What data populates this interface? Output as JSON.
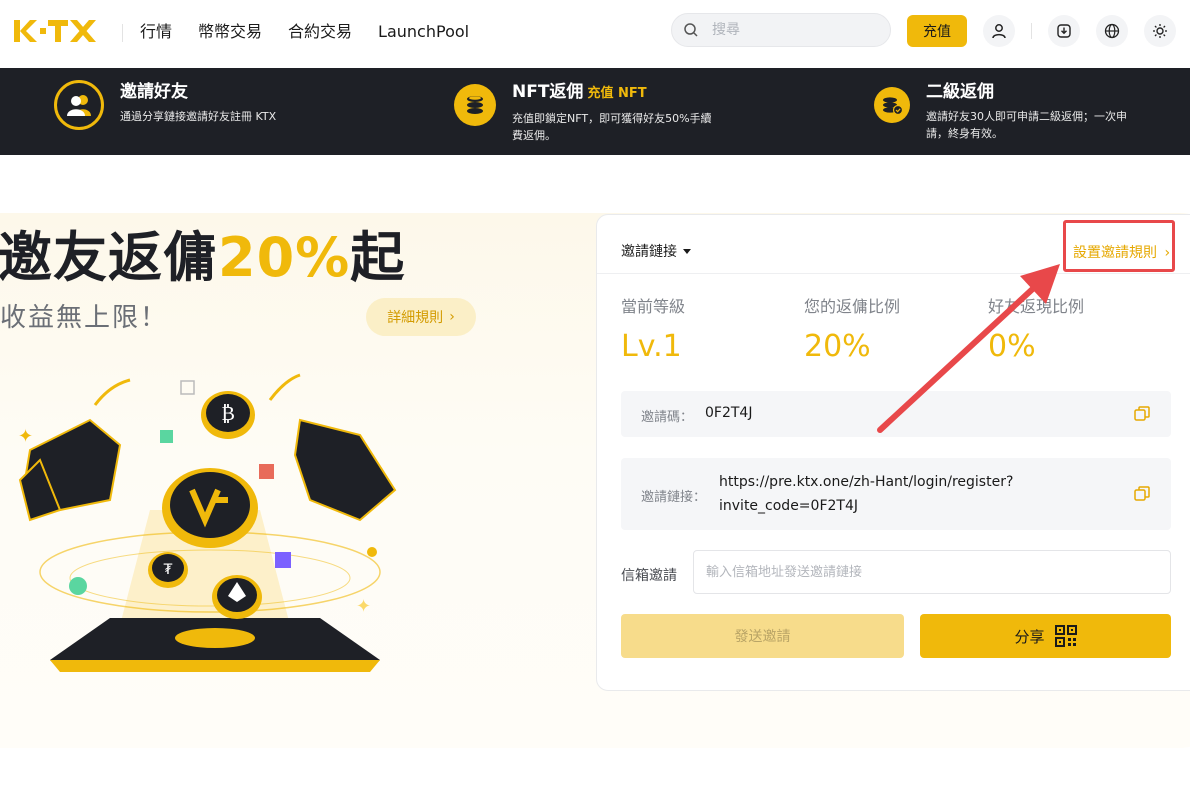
{
  "nav": {
    "links": [
      "行情",
      "幣幣交易",
      "合約交易",
      "LaunchPool"
    ],
    "search_placeholder": "搜尋",
    "deposit_label": "充值",
    "icons": [
      "search-icon",
      "user-icon",
      "download-icon",
      "globe-icon",
      "theme-sun-icon"
    ]
  },
  "banner": {
    "items": [
      {
        "title": "邀請好友",
        "highlight": "",
        "desc": "通過分享鏈接邀請好友註冊 KTX",
        "icon": "friends-icon"
      },
      {
        "title": "NFT返佣",
        "highlight": "充值 NFT",
        "desc": "充值即鎖定NFT，即可獲得好友50%手續費返佣。",
        "icon": "coin-stack-icon"
      },
      {
        "title": "二級返佣",
        "highlight": "",
        "desc": "邀請好友30人即可申請二級返佣；一次申請，終身有效。",
        "icon": "coin-stack-check-icon"
      }
    ]
  },
  "hero": {
    "title_prefix": "邀友返傭",
    "title_pct": "20%",
    "title_suffix": "起",
    "subtitle": "收益無上限！",
    "rules_label": "詳細規則"
  },
  "card": {
    "link_select": "邀請鏈接",
    "set_rules": "設置邀請規則",
    "stats": [
      {
        "label": "當前等級",
        "value": "Lv.1"
      },
      {
        "label": "您的返傭比例",
        "value": "20%"
      },
      {
        "label": "好友返現比例",
        "value": "0%"
      }
    ],
    "invite_code_label": "邀請碼：",
    "invite_code": "0F2T4J",
    "invite_link_label": "邀請鏈接：",
    "invite_link_line1": "https://pre.ktx.one/zh-Hant/login/register?",
    "invite_link_line2": "invite_code=0F2T4J",
    "email_label": "信箱邀請",
    "email_placeholder": "輸入信箱地址發送邀請鏈接",
    "send_label": "發送邀請",
    "share_label": "分享"
  },
  "colors": {
    "accent": "#f0b90b",
    "banner_bg": "#1e2026",
    "annotation_red": "#e8484a"
  }
}
